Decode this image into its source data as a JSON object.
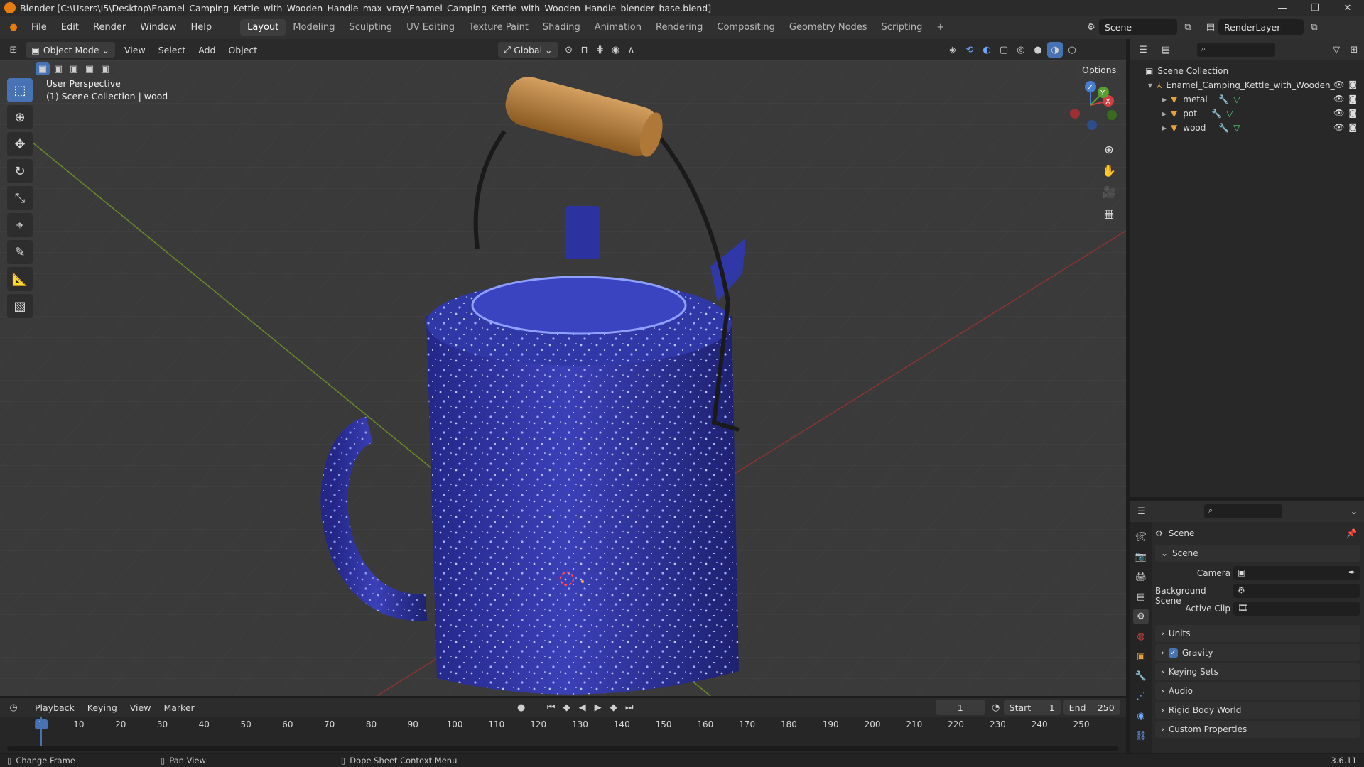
{
  "title_bar": {
    "title": "Blender [C:\\Users\\I5\\Desktop\\Enamel_Camping_Kettle_with_Wooden_Handle_max_vray\\Enamel_Camping_Kettle_with_Wooden_Handle_blender_base.blend]",
    "minimize": "—",
    "maximize": "❐",
    "close": "✕"
  },
  "menu": [
    "File",
    "Edit",
    "Render",
    "Window",
    "Help"
  ],
  "workspaces": [
    "Layout",
    "Modeling",
    "Sculpting",
    "UV Editing",
    "Texture Paint",
    "Shading",
    "Animation",
    "Rendering",
    "Compositing",
    "Geometry Nodes",
    "Scripting"
  ],
  "active_workspace": "Layout",
  "add_workspace": "+",
  "scene_selector": {
    "label": "Scene"
  },
  "view_layer_selector": {
    "label": "RenderLayer"
  },
  "viewport_header": {
    "mode": "Object Mode",
    "menus": [
      "View",
      "Select",
      "Add",
      "Object"
    ],
    "transform_orientation": "Global",
    "options": "Options"
  },
  "viewport": {
    "perspective": "User Perspective",
    "collection_info": "(1) Scene Collection | wood"
  },
  "outliner": {
    "root": "Scene Collection",
    "collection": "Enamel_Camping_Kettle_with_Wooden_",
    "objects": [
      "metal",
      "pot",
      "wood"
    ]
  },
  "properties": {
    "header": "Scene",
    "section_scene": "Scene",
    "fields": [
      {
        "label": "Camera",
        "value": ""
      },
      {
        "label": "Background Scene",
        "value": ""
      },
      {
        "label": "Active Clip",
        "value": ""
      }
    ],
    "collapsed_sections": [
      "Units",
      "Gravity",
      "Keying Sets",
      "Audio",
      "Rigid Body World",
      "Custom Properties"
    ],
    "gravity_checked": true
  },
  "timeline": {
    "menus": [
      "Playback",
      "Keying",
      "View",
      "Marker"
    ],
    "current_frame": "1",
    "start_label": "Start",
    "start": "1",
    "end_label": "End",
    "end": "250",
    "ruler": [
      "1",
      "10",
      "20",
      "30",
      "40",
      "50",
      "60",
      "70",
      "80",
      "90",
      "100",
      "110",
      "120",
      "130",
      "140",
      "150",
      "160",
      "170",
      "180",
      "190",
      "200",
      "210",
      "220",
      "230",
      "240",
      "250"
    ]
  },
  "status_bar": {
    "items": [
      "Change Frame",
      "Pan View",
      "Dope Sheet Context Menu"
    ],
    "version": "3.6.11"
  },
  "colors": {
    "accent": "#4772b3",
    "frame_marker": "#4772b3",
    "enamel": "#2c2f9a",
    "wood": "#b8843c"
  }
}
